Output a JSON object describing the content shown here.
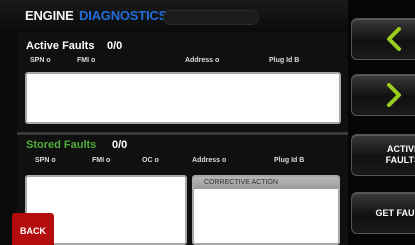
{
  "header": {
    "title_engine": "ENGINE",
    "title_diagnostics": "DIAGNOSTICS"
  },
  "active_faults": {
    "title": "Active Faults",
    "count": "0/0",
    "columns": [
      "SPN",
      "FMI",
      "Address",
      "Plug Id"
    ],
    "sort_icons": [
      "o",
      "o",
      "o",
      "B"
    ]
  },
  "stored_faults": {
    "title": "Stored Faults",
    "count": "0/0",
    "columns": [
      "SPN",
      "FMI",
      "OC",
      "Address",
      "Plug Id"
    ],
    "sort_icons": [
      "o",
      "o",
      "o",
      "o",
      "B"
    ]
  },
  "corrective_action": {
    "label": "CORRECTIVE ACTION"
  },
  "buttons": {
    "back": "BACK",
    "active_faults_line1": "ACTIVE",
    "active_faults_line2": "FAULTS",
    "get_faults": "GET FAUL"
  },
  "colors": {
    "diagnostics_title": "#1e6fd9",
    "stored_title": "#4fae38",
    "arrow": "#9acd1e",
    "back_button": "#b40c0c"
  },
  "icons": {
    "previous": "chevron-left-icon",
    "next": "chevron-right-icon"
  }
}
